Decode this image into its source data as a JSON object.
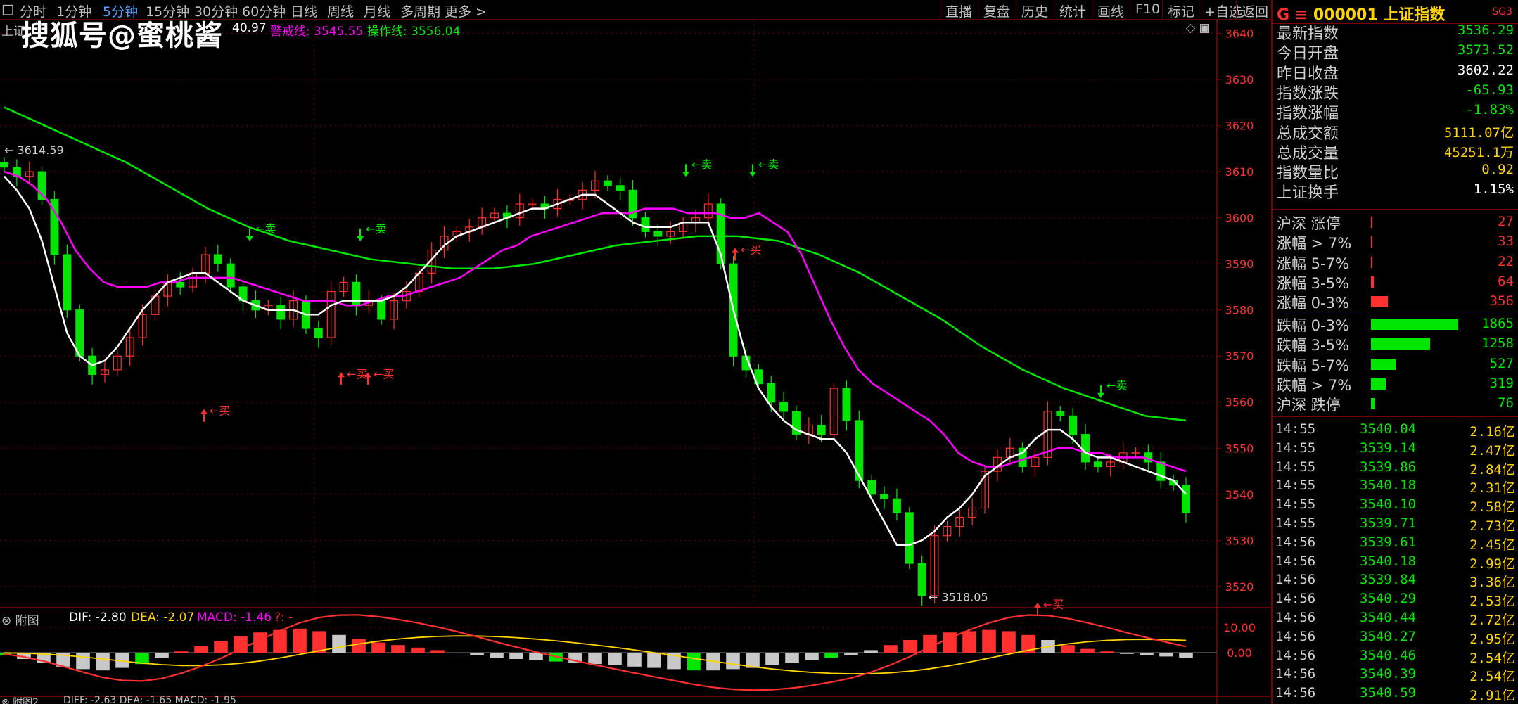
{
  "toolbar": {
    "periods": [
      {
        "label": "分时",
        "active": false
      },
      {
        "label": "1分钟",
        "active": false
      },
      {
        "label": "5分钟",
        "active": true
      },
      {
        "label": "15分钟",
        "active": false
      },
      {
        "label": "30分钟",
        "active": false
      },
      {
        "label": "60分钟",
        "active": false
      },
      {
        "label": "日线",
        "active": false
      },
      {
        "label": "周线",
        "active": false
      },
      {
        "label": "月线",
        "active": false
      },
      {
        "label": "多周期",
        "active": false
      },
      {
        "label": "更多 >",
        "active": false
      }
    ],
    "right_buttons": [
      "直播",
      "复盘",
      "历史",
      "统计",
      "画线",
      "F10",
      "标记",
      "+自选",
      "返回"
    ]
  },
  "watermark": "搜狐号@蜜桃酱",
  "chart": {
    "title_prefix": "上证",
    "ma1_value": "40.97",
    "alert_line": "警戒线: 3545.55",
    "op_line": "操作线: 3556.04",
    "high_label": "3614.59",
    "low_label": "3518.05",
    "signal_buy": "买",
    "signal_sell": "卖",
    "colors": {
      "up": "#ff3030",
      "down": "#00e600",
      "ma_white": "#ffffff",
      "ma_magenta": "#ff00ff",
      "ma_green": "#00e600",
      "grid": "#6a0000"
    }
  },
  "sub_chart": {
    "title": "附图",
    "dif": "DIF: -2.80",
    "dea": "DEA: -2.07",
    "macd": "MACD: -1.46",
    "extra": "?: -",
    "axis_labels": [
      "10.00",
      "0.00"
    ],
    "next_title": "附图2",
    "next_text": "DIFF: -2.63 DEA: -1.65 MACD: -1.95"
  },
  "quote": {
    "code_line": "000001 上证指数",
    "prefix": "G ≡",
    "tag": "SG3",
    "rows": [
      {
        "label": "最新指数",
        "value": "3536.29",
        "color": "#00e600"
      },
      {
        "label": "今日开盘",
        "value": "3573.52",
        "color": "#00e600"
      },
      {
        "label": "昨日收盘",
        "value": "3602.22",
        "color": "#ffffff"
      },
      {
        "label": "指数涨跌",
        "value": "-65.93",
        "color": "#00e600"
      },
      {
        "label": "指数涨幅",
        "value": "-1.83%",
        "color": "#00e600"
      },
      {
        "label": "总成交额",
        "value": "5111.07亿",
        "color": "#ffd400"
      },
      {
        "label": "总成交量",
        "value": "45251.1万",
        "color": "#ffd400"
      },
      {
        "label": "指数量比",
        "value": "0.92",
        "color": "#ffd400"
      },
      {
        "label": "上证换手",
        "value": "1.15%",
        "color": "#ffffff"
      }
    ],
    "breadth": [
      {
        "label": "沪深 涨停",
        "value": "27",
        "color": "#ff3030",
        "count": 27
      },
      {
        "label": "涨幅 > 7%",
        "value": "33",
        "color": "#ff3030",
        "count": 33
      },
      {
        "label": "涨幅 5-7%",
        "value": "22",
        "color": "#ff3030",
        "count": 22
      },
      {
        "label": "涨幅 3-5%",
        "value": "64",
        "color": "#ff3030",
        "count": 64
      },
      {
        "label": "涨幅 0-3%",
        "value": "356",
        "color": "#ff3030",
        "count": 356
      },
      {
        "label": "跌幅 0-3%",
        "value": "1865",
        "color": "#00e600",
        "count": 1865
      },
      {
        "label": "跌幅 3-5%",
        "value": "1258",
        "color": "#00e600",
        "count": 1258
      },
      {
        "label": "跌幅 5-7%",
        "value": "527",
        "color": "#00e600",
        "count": 527
      },
      {
        "label": "跌幅 > 7%",
        "value": "319",
        "color": "#00e600",
        "count": 319
      },
      {
        "label": "沪深 跌停",
        "value": "76",
        "color": "#00e600",
        "count": 76
      }
    ],
    "ticks": [
      {
        "time": "14:55",
        "price": "3540.04",
        "vol": "2.16亿"
      },
      {
        "time": "14:55",
        "price": "3539.14",
        "vol": "2.47亿"
      },
      {
        "time": "14:55",
        "price": "3539.86",
        "vol": "2.84亿"
      },
      {
        "time": "14:55",
        "price": "3540.18",
        "vol": "2.31亿"
      },
      {
        "time": "14:55",
        "price": "3540.10",
        "vol": "2.58亿"
      },
      {
        "time": "14:55",
        "price": "3539.71",
        "vol": "2.73亿"
      },
      {
        "time": "14:56",
        "price": "3539.61",
        "vol": "2.45亿"
      },
      {
        "time": "14:56",
        "price": "3540.18",
        "vol": "2.99亿"
      },
      {
        "time": "14:56",
        "price": "3539.84",
        "vol": "3.36亿"
      },
      {
        "time": "14:56",
        "price": "3540.29",
        "vol": "2.53亿"
      },
      {
        "time": "14:56",
        "price": "3540.44",
        "vol": "2.72亿"
      },
      {
        "time": "14:56",
        "price": "3540.27",
        "vol": "2.95亿"
      },
      {
        "time": "14:56",
        "price": "3540.46",
        "vol": "2.54亿"
      },
      {
        "time": "14:56",
        "price": "3540.39",
        "vol": "2.54亿"
      },
      {
        "time": "14:56",
        "price": "3540.59",
        "vol": "2.91亿"
      }
    ]
  },
  "chart_data": {
    "type": "candlestick",
    "y_axis_ticks": [
      3640,
      3630,
      3620,
      3610,
      3600,
      3590,
      3580,
      3570,
      3560,
      3550,
      3540,
      3530,
      3520
    ],
    "ylim": [
      3516,
      3643
    ],
    "grid": true,
    "close_path": [
      3611,
      3609,
      3610,
      3604,
      3592,
      3580,
      3570,
      3566,
      3567,
      3570,
      3574,
      3579,
      3583,
      3586,
      3585,
      3588,
      3592,
      3590,
      3585,
      3582,
      3580,
      3581,
      3578,
      3582,
      3576,
      3574,
      3584,
      3586,
      3581,
      3582,
      3578,
      3582,
      3584,
      3588,
      3593,
      3596,
      3597,
      3598,
      3600,
      3601,
      3600,
      3603,
      3603,
      3602,
      3604,
      3604,
      3606,
      3608,
      3607,
      3606,
      3600,
      3597,
      3596,
      3597,
      3599,
      3600,
      3603,
      3590,
      3570,
      3567,
      3564,
      3560,
      3558,
      3553,
      3555,
      3553,
      3563,
      3556,
      3543,
      3540,
      3539,
      3536,
      3525,
      3518,
      3531,
      3533,
      3535,
      3537,
      3545,
      3548,
      3550,
      3546,
      3548,
      3558,
      3557,
      3553,
      3547,
      3546,
      3547,
      3549,
      3549,
      3547,
      3543,
      3542,
      3536
    ],
    "ma_white": [
      3609,
      3606,
      3602,
      3595,
      3585,
      3575,
      3570,
      3568,
      3569,
      3572,
      3576,
      3580,
      3583,
      3586,
      3587,
      3588,
      3588,
      3586,
      3584,
      3582,
      3581,
      3580,
      3580,
      3580,
      3579,
      3579,
      3581,
      3582,
      3582,
      3582,
      3582,
      3583,
      3585,
      3588,
      3591,
      3594,
      3596,
      3597,
      3598,
      3599,
      3600,
      3601,
      3602,
      3602,
      3603,
      3604,
      3605,
      3605,
      3603,
      3601,
      3599,
      3598,
      3598,
      3598,
      3599,
      3599,
      3599,
      3592,
      3580,
      3570,
      3563,
      3559,
      3556,
      3554,
      3553,
      3552,
      3552,
      3549,
      3544,
      3539,
      3534,
      3529,
      3529,
      3530,
      3532,
      3535,
      3537,
      3540,
      3544,
      3546,
      3548,
      3549,
      3552,
      3554,
      3554,
      3552,
      3549,
      3548,
      3548,
      3547,
      3546,
      3545,
      3544,
      3543,
      3540
    ],
    "ma_magenta": [
      3610,
      3609,
      3607,
      3604,
      3599,
      3593,
      3589,
      3586,
      3585,
      3585,
      3585,
      3586,
      3586,
      3587,
      3587,
      3587,
      3587,
      3586,
      3585,
      3584,
      3583,
      3582,
      3582,
      3582,
      3581,
      3581,
      3582,
      3583,
      3583,
      3584,
      3585,
      3586,
      3587,
      3589,
      3591,
      3593,
      3594,
      3596,
      3597,
      3598,
      3599,
      3600,
      3601,
      3601,
      3601,
      3602,
      3602,
      3602,
      3601,
      3601,
      3601,
      3600,
      3600,
      3601,
      3599,
      3597,
      3592,
      3585,
      3578,
      3572,
      3567,
      3564,
      3562,
      3560,
      3558,
      3556,
      3553,
      3549,
      3547,
      3546,
      3546,
      3547,
      3548,
      3549,
      3550,
      3550,
      3549,
      3549,
      3548,
      3548,
      3548,
      3547,
      3546,
      3545
    ],
    "ma_green": [
      3624,
      3620,
      3616,
      3612,
      3607,
      3602,
      3598,
      3595,
      3593,
      3591,
      3590,
      3589,
      3589,
      3590,
      3592,
      3594,
      3595,
      3596,
      3596,
      3595,
      3592,
      3588,
      3583,
      3578,
      3572,
      3567,
      3563,
      3560,
      3557,
      3556
    ],
    "signals": [
      {
        "type": "sell",
        "price": 3608
      },
      {
        "type": "sell",
        "price": 3608
      },
      {
        "type": "sell",
        "price": 3594
      },
      {
        "type": "sell",
        "price": 3594
      },
      {
        "type": "sell",
        "price": 3560
      },
      {
        "type": "buy",
        "price": 3568
      },
      {
        "type": "buy",
        "price": 3568
      },
      {
        "type": "buy",
        "price": 3560
      },
      {
        "type": "buy",
        "price": 3595
      },
      {
        "type": "buy",
        "price": 3518
      }
    ],
    "macd_hist": [
      -1.0,
      -2.5,
      -4.0,
      -5.5,
      -6.5,
      -7.0,
      -6.0,
      -4.5,
      -2.0,
      0.5,
      2.5,
      4.5,
      6.5,
      8.0,
      9.0,
      9.5,
      8.5,
      7.0,
      5.5,
      4.0,
      3.0,
      2.0,
      1.0,
      0.0,
      -1.0,
      -2.0,
      -2.5,
      -3.0,
      -3.5,
      -4.0,
      -4.5,
      -5.0,
      -5.5,
      -6.0,
      -6.5,
      -7.0,
      -7.0,
      -6.5,
      -6.0,
      -5.0,
      -4.0,
      -3.0,
      -2.0,
      -1.0,
      1.0,
      3.0,
      5.0,
      7.0,
      8.0,
      8.5,
      9.0,
      8.5,
      7.0,
      5.0,
      3.0,
      1.5,
      0.5,
      -0.5,
      -1.0,
      -1.5,
      -2.0
    ]
  }
}
